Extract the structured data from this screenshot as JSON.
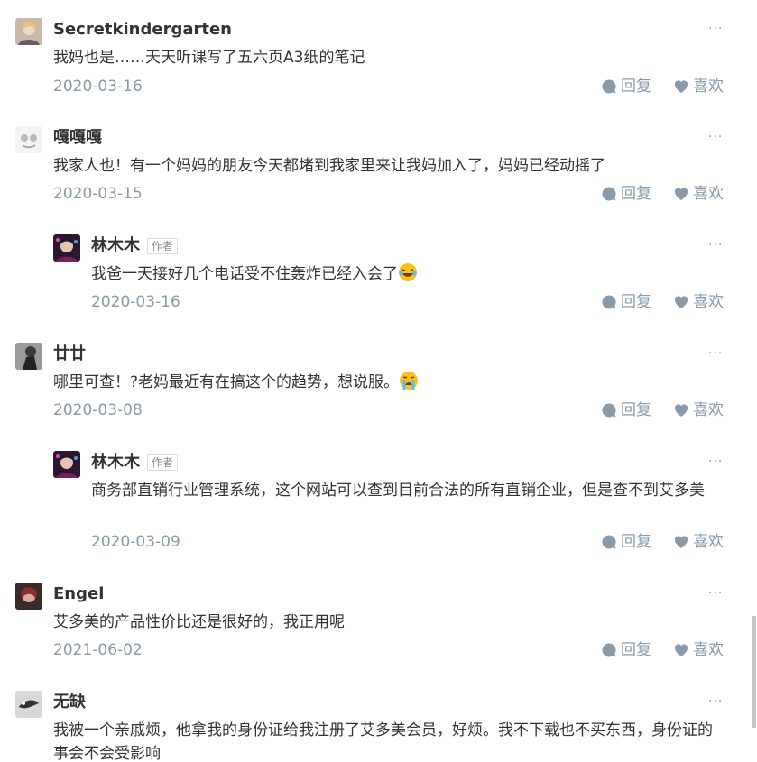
{
  "actions": {
    "reply_label": "回复",
    "like_label": "喜欢",
    "author_tag": "作者",
    "more": "···"
  },
  "comments": [
    {
      "name": "Secretkindergarten",
      "text": "我妈也是……天天听课写了五六页A3纸的笔记",
      "date": "2020-03-16"
    },
    {
      "name": "嘎嘎嘎",
      "text": "我家人也！有一个妈妈的朋友今天都堵到我家里来让我妈加入了，妈妈已经动摇了",
      "date": "2020-03-15"
    },
    {
      "name": "林木木",
      "text": "我爸一天接好几个电话受不住轰炸已经入会了",
      "date": "2020-03-16"
    },
    {
      "name": "廿廿",
      "text": "哪里可查！?老妈最近有在搞这个的趋势，想说服。",
      "date": "2020-03-08"
    },
    {
      "name": "林木木",
      "text": "商务部直销行业管理系统，这个网站可以查到目前合法的所有直销企业，但是查不到艾多美",
      "date": "2020-03-09"
    },
    {
      "name": "Engel",
      "text": "艾多美的产品性价比还是很好的，我正用呢",
      "date": "2021-06-02"
    },
    {
      "name": "无缺",
      "text": "我被一个亲戚烦，他拿我的身份证给我注册了艾多美会员，好烦。我不下载也不买东西，身份证的事会不会受影响"
    }
  ]
}
